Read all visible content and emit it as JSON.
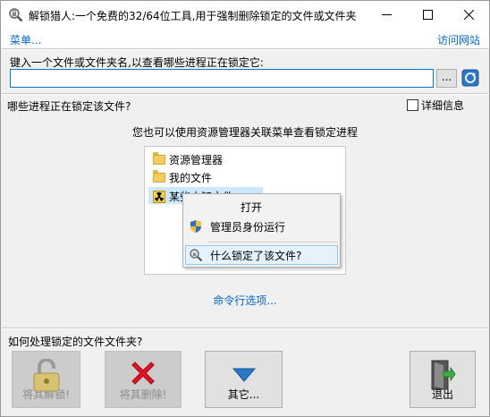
{
  "window": {
    "title": "解锁猎人:一个免费的32/64位工具,用于强制删除锁定的文件或文件夹"
  },
  "menubar": {
    "menu_label": "菜单...",
    "visit_label": "访问网站"
  },
  "input_section": {
    "prompt": "键入一个文件或文件夹名,以查看哪些进程正在锁定它:",
    "value": "",
    "browse_label": "..."
  },
  "process_section": {
    "label": "哪些进程正在锁定该文件?",
    "detail_label": "详细信息",
    "detail_checked": false,
    "hint": "您也可以使用资源管理器关联菜单查看锁定进程"
  },
  "illustration": {
    "items": [
      "资源管理器",
      "我的文件",
      "某些未知文件"
    ],
    "context_menu": [
      "打开",
      "管理员身份运行",
      "什么锁定了该文件?"
    ]
  },
  "cmd_link": "命令行选项...",
  "actions": {
    "label": "如何处理锁定的文件文件夹?",
    "unlock_label": "将其解锁!",
    "delete_label": "将其删除!",
    "other_label": "其它...",
    "exit_label": "退出"
  },
  "colors": {
    "link": "#0066cc",
    "input_border": "#0078d7",
    "delete_red": "#e81123"
  }
}
